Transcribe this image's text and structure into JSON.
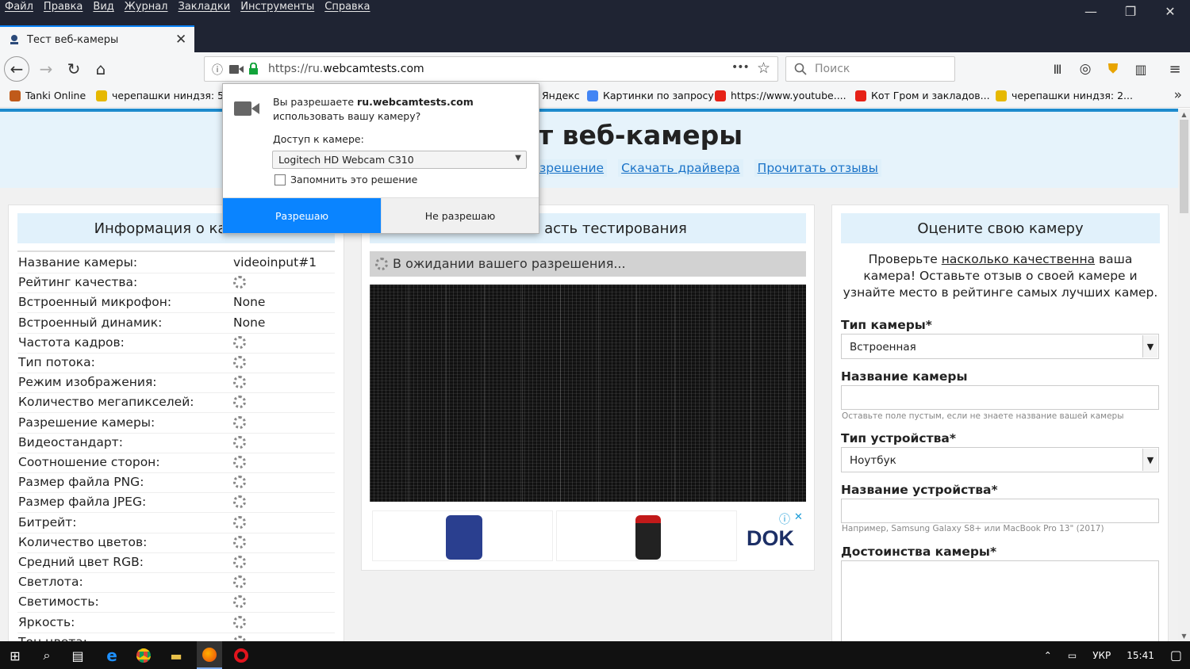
{
  "menubar": {
    "items": [
      "Файл",
      "Правка",
      "Вид",
      "Журнал",
      "Закладки",
      "Инструменты",
      "Справка"
    ]
  },
  "tab": {
    "title": "Тест веб-камеры",
    "close": "✕",
    "new": "+"
  },
  "navbar": {
    "url_scheme": "https://ru.",
    "url_host": "webcamtests.com",
    "search_placeholder": "Поиск",
    "menu_dots": "•••"
  },
  "bookmarks": [
    {
      "label": "Tanki Online",
      "icon": "tank-icon",
      "color": "#c05a1a"
    },
    {
      "label": "черепашки ниндзя: 5 ...",
      "icon": "play-icon",
      "color": "#e6b800"
    },
    {
      "label": "Яндекс",
      "icon": "yandex-icon",
      "color": "#ffffff"
    },
    {
      "label": "Картинки по запросу",
      "icon": "google-icon",
      "color": "#4285f4"
    },
    {
      "label": "https://www.youtube....",
      "icon": "youtube-icon",
      "color": "#e62117"
    },
    {
      "label": "Кот Гром и закладов...",
      "icon": "youtube-icon",
      "color": "#e62117"
    },
    {
      "label": "черепашки ниндзя: 2...",
      "icon": "play-icon",
      "color": "#e6b800"
    }
  ],
  "hero": {
    "title": "т веб-камеры",
    "links": [
      "зрешение",
      "Скачать драйвера",
      "Прочитать отзывы"
    ]
  },
  "info_panel": {
    "header": "Информация о ка",
    "rows": [
      {
        "key": "Название камеры:",
        "value": "videoinput#1"
      },
      {
        "key": "Рейтинг качества:",
        "value": ""
      },
      {
        "key": "Встроенный микрофон:",
        "value": "None"
      },
      {
        "key": "Встроенный динамик:",
        "value": "None"
      },
      {
        "key": "Частота кадров:",
        "value": ""
      },
      {
        "key": "Тип потока:",
        "value": ""
      },
      {
        "key": "Режим изображения:",
        "value": ""
      },
      {
        "key": "Количество мегапикселей:",
        "value": ""
      },
      {
        "key": "Разрешение камеры:",
        "value": ""
      },
      {
        "key": "Видеостандарт:",
        "value": ""
      },
      {
        "key": "Соотношение сторон:",
        "value": ""
      },
      {
        "key": "Размер файла PNG:",
        "value": ""
      },
      {
        "key": "Размер файла JPEG:",
        "value": ""
      },
      {
        "key": "Битрейт:",
        "value": ""
      },
      {
        "key": "Количество цветов:",
        "value": ""
      },
      {
        "key": "Средний цвет RGB:",
        "value": ""
      },
      {
        "key": "Светлота:",
        "value": ""
      },
      {
        "key": "Светимость:",
        "value": ""
      },
      {
        "key": "Яркость:",
        "value": ""
      },
      {
        "key": "Тон цвета:",
        "value": ""
      }
    ]
  },
  "test_panel": {
    "header": "асть тестирования",
    "waiting": "В ожидании вашего разрешения...",
    "ad_brand": "DOK"
  },
  "rate_panel": {
    "header": "Оцените свою камеру",
    "intro_1": "Проверьте ",
    "intro_link": "насколько качественна",
    "intro_2": " ваша камера! Оставьте отзыв о своей камере и узнайте место в рейтинге самых лучших камер.",
    "camera_type_label": "Тип камеры*",
    "camera_type_value": "Встроенная",
    "camera_name_label": "Название камеры",
    "camera_name_hint": "Оставьте поле пустым, если не знаете название вашей камеры",
    "device_type_label": "Тип устройства*",
    "device_type_value": "Ноутбук",
    "device_name_label": "Название устройства*",
    "device_name_hint": "Например, Samsung Galaxy S8+ или MacBook Pro 13\" (2017)",
    "merits_label": "Достоинства камеры*"
  },
  "popup": {
    "msg_prefix": "Вы разрешаете ",
    "msg_host": "ru.webcamtests.com",
    "msg_suffix": " использовать вашу камеру?",
    "access_label": "Доступ к камере:",
    "camera_option": "Logitech HD Webcam C310",
    "remember": "Запомнить это решение",
    "allow": "Разрешаю",
    "deny": "Не разрешаю"
  },
  "taskbar": {
    "lang": "УКР",
    "time": "15:41"
  }
}
